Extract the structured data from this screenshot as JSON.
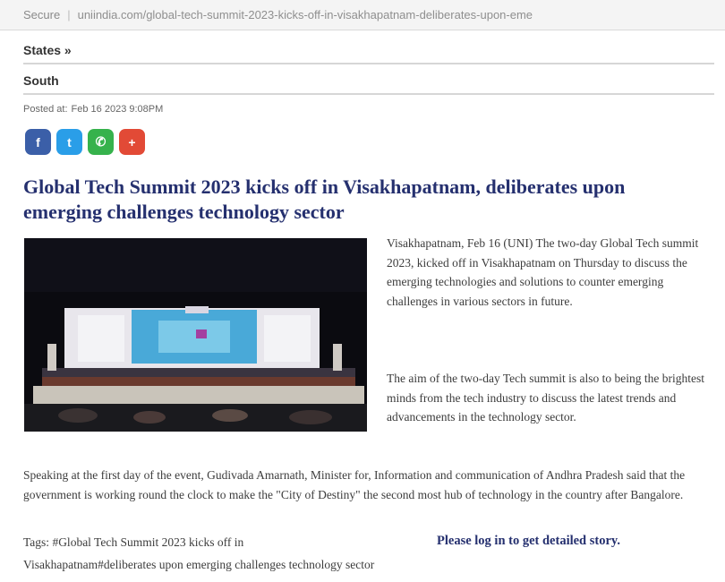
{
  "browser": {
    "secure_label": "Secure",
    "url": "uniindia.com/global-tech-summit-2023-kicks-off-in-visakhapatnam-deliberates-upon-eme"
  },
  "nav": {
    "states": "States »",
    "south": "South"
  },
  "article": {
    "posted_label": "Posted at:",
    "posted_date": "Feb 16 2023 9:08PM",
    "share_buttons": [
      {
        "icon": "facebook-icon",
        "glyph": "f",
        "color": "#3b5fa8"
      },
      {
        "icon": "twitter-icon",
        "glyph": "t",
        "color": "#2a9ee8"
      },
      {
        "icon": "whatsapp-icon",
        "glyph": "✆",
        "color": "#36b24c"
      },
      {
        "icon": "google-plus-icon",
        "glyph": "+",
        "color": "#e24a36"
      }
    ],
    "headline": "Global Tech Summit 2023 kicks off in Visakhapatnam, deliberates upon emerging challenges technology sector",
    "paragraph1": "Visakhapatnam, Feb 16 (UNI) The two-day Global Tech summit 2023, kicked off in Visakhapatnam on Thursday to discuss the emerging technologies and solutions to counter emerging challenges in various sectors in future.",
    "paragraph2": "The aim of the two-day Tech summit is also to being the brightest minds from the tech industry to discuss the latest trends and advancements in the technology sector.",
    "paragraph3": "Speaking at the first day of the event, Gudivada Amarnath, Minister for, Information and communication of Andhra Pradesh said that the government is working round the clock to make the \"City of Destiny\" the second most hub of technology in the country after Bangalore.",
    "tags_label": "Tags:",
    "tags_line1": "#Global Tech Summit 2023 kicks off in",
    "tags_line2": "Visakhapatnam#deliberates upon emerging challenges technology sector",
    "login_prompt": "Please log in to get detailed story."
  }
}
